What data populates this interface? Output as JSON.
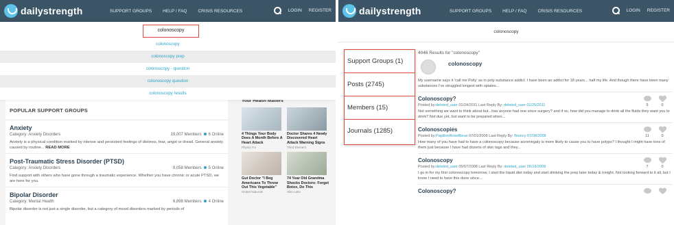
{
  "brand": {
    "name": "dailystrength",
    "logo_color": "#5ec3e8",
    "nav_bg": "#3b5566"
  },
  "nav": {
    "links": [
      "SUPPORT GROUPS",
      "HELP / FAQ",
      "CRISIS RESOURCES"
    ],
    "login": "LOGIN",
    "register": "REGISTER"
  },
  "left": {
    "search": {
      "value": "colonoscopy"
    },
    "suggestions": [
      "colonoscopy",
      "colonoscopy prep",
      "colonoscopy - question",
      "colonoscopy question",
      "colonoscopy results"
    ],
    "popular_title": "POPULAR SUPPORT GROUPS",
    "groups": [
      {
        "title": "Anxiety",
        "category": "Category: Anxiety Disorders",
        "members": "19,007 Members",
        "online": "6 Online",
        "desc": "Anxiety is a physical condition marked by intense and persistent feelings of distress, fear, angst or dread. General anxiety caused by routine...",
        "read_more": "READ MORE"
      },
      {
        "title": "Post-Traumatic Stress Disorder (PTSD)",
        "category": "Category: Anxiety Disorders",
        "members": "8,058 Members",
        "online": "5 Online",
        "desc": "Find support with others who have gone through a traumatic experience. Whether you have chronic or acute PTSD, we are here for you."
      },
      {
        "title": "Bipolar Disorder",
        "category": "Category: Mental Health",
        "members": "6,898 Members",
        "online": "4 Online",
        "desc": "Bipolar disorder is not just a single disorder, but a category of mood disorders marked by periods of"
      }
    ],
    "side_title": "Your Health Matters",
    "ads": [
      {
        "title": "4 Things Your Body Does A Month Before A Heart Attack",
        "source": "Physio Tru"
      },
      {
        "title": "Doctor Shares 4 Newly Discovered Heart Attack Warning Signs",
        "source": "Third Element"
      },
      {
        "title": "Gut Doctor \"I Beg Americans To Throw Out This Vegetable\"",
        "source": "United Naturals"
      },
      {
        "title": "74 Year Old Grandma Shocks Doctors: Forget Botox, Do This",
        "source": "Skin Labs"
      }
    ]
  },
  "right": {
    "query": "colonoscopy",
    "tabs": [
      "Support Groups (1)",
      "Posts (2745)",
      "Members (15)",
      "Journals (1285)"
    ],
    "results_count": "4046 Results for \"colonoscopy\"",
    "member": {
      "name": "colonoscopy",
      "desc": "My username says it 'call me Polly' as in poly-substance addict. I have been an addict for 18 years... half my life. And though there have been many substances I've struggled longest with opiates..."
    },
    "results": [
      {
        "title": "Colonoscopy?",
        "posted_by_label": "Posted by:",
        "author": "deleted_user",
        "date": "01/24/2011",
        "last_reply_label": "Last Reply By:",
        "last_user": "deleted_user 01/25/2011",
        "desc": "Not something we want to think about but...has anyone had one since surgery? and if so, how did you manage to drink all the fluids they want you to drink? Not due yet, but want to be prepared when...",
        "comments": "5",
        "likes": "0"
      },
      {
        "title": "Colonoscopies",
        "posted_by_label": "Posted by:",
        "author": "PapillonRoseBleue",
        "date": "07/01/2008",
        "last_reply_label": "Last Reply By:",
        "last_user": "flouncy 07/08/2008",
        "desc": "How many of you have had to have a colonoscopy because acromegaly is more likely to cause you to have polyps? I thought I might have tons of them just because I have had dozens of skin tags and they...",
        "comments": "11",
        "likes": "0"
      },
      {
        "title": "Colonoscopy",
        "posted_by_label": "Posted by:",
        "author": "deleted_user",
        "date": "05/07/2008",
        "last_reply_label": "Last Reply By:",
        "last_user": "deleted_user 05/16/2008",
        "desc": "I go in for my first colonoscopy tomorrow. I start the liquid diet today and start drinking the prep later today & tonight. Not looking forward to it all, but I know I need to have this done since...",
        "comments": "7",
        "likes": "0"
      },
      {
        "title": "Colonoscopy?",
        "posted_by_label": "",
        "author": "",
        "date": "",
        "last_reply_label": "",
        "last_user": "",
        "desc": "",
        "comments": "",
        "likes": ""
      }
    ]
  }
}
